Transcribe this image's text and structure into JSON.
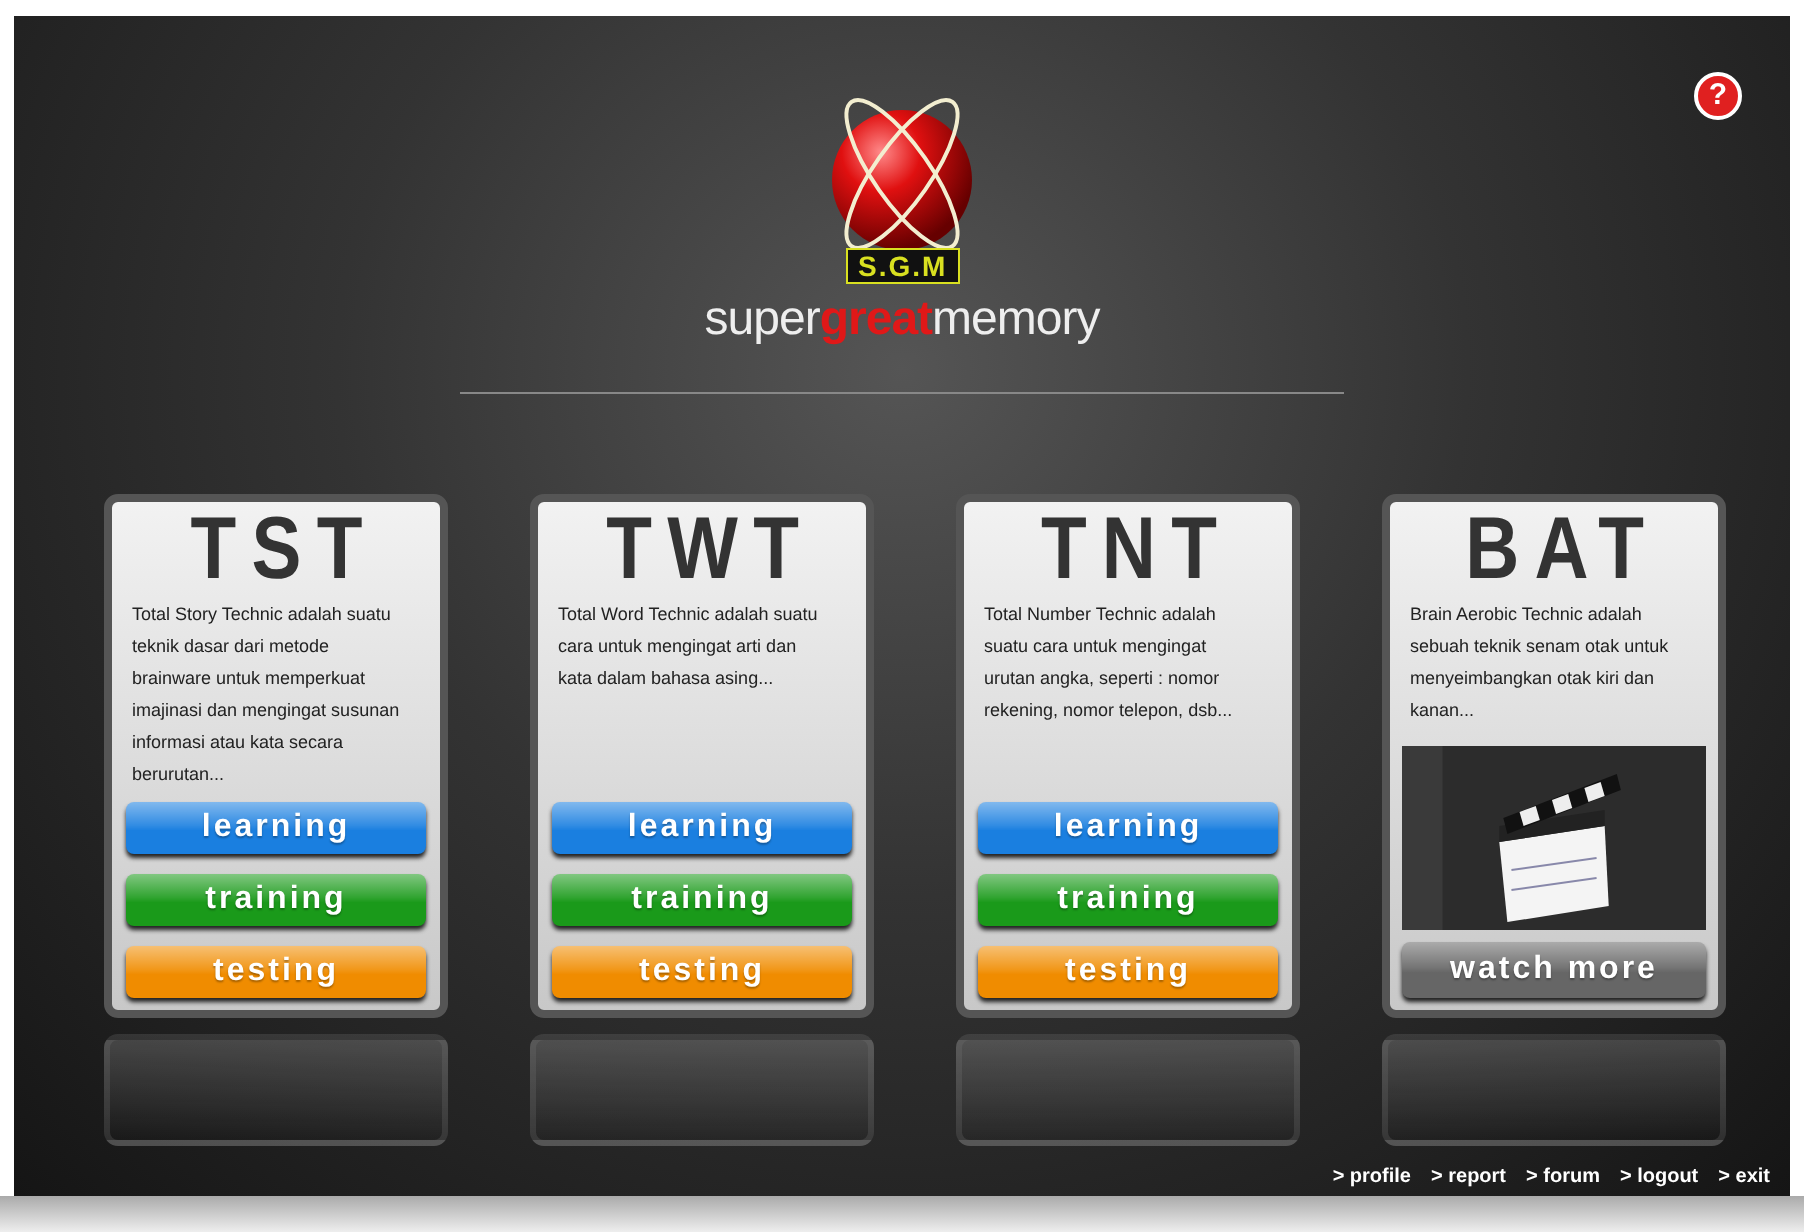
{
  "logo": {
    "badge": "S.G.M",
    "wordmark": "super**great**memory"
  },
  "help": {
    "label": "?"
  },
  "cards": [
    {
      "title": "TST",
      "kind": "buttons",
      "description": "Total Story Technic adalah suatu teknik dasar dari metode brainware untuk memperkuat imajinasi dan mengingat susunan informasi atau kata secara berurutan...",
      "buttons": [
        {
          "label": "learning",
          "color": "#1a7fe0"
        },
        {
          "label": "training",
          "color": "#1a9a1a"
        },
        {
          "label": "testing",
          "color": "#f08c00"
        }
      ]
    },
    {
      "title": "TWT",
      "kind": "buttons",
      "description": "Total Word Technic adalah suatu cara untuk mengingat arti dan kata dalam bahasa asing...",
      "buttons": [
        {
          "label": "learning",
          "color": "#1a7fe0"
        },
        {
          "label": "training",
          "color": "#1a9a1a"
        },
        {
          "label": "testing",
          "color": "#f08c00"
        }
      ]
    },
    {
      "title": "TNT",
      "kind": "buttons",
      "description": "Total Number Technic adalah suatu cara untuk mengingat urutan angka, seperti : nomor rekening, nomor telepon, dsb...",
      "buttons": [
        {
          "label": "learning",
          "color": "#1a7fe0"
        },
        {
          "label": "training",
          "color": "#1a9a1a"
        },
        {
          "label": "testing",
          "color": "#f08c00"
        }
      ]
    },
    {
      "title": "BAT",
      "kind": "video",
      "description": "Brain Aerobic Technic adalah sebuah teknik senam otak untuk menyeimbangkan otak kiri dan kanan...",
      "buttons": [
        {
          "label": "watch more",
          "color": "#666666"
        }
      ]
    }
  ],
  "footer_links": [
    "> profile",
    "> report",
    "> forum",
    "> logout",
    "> exit"
  ]
}
